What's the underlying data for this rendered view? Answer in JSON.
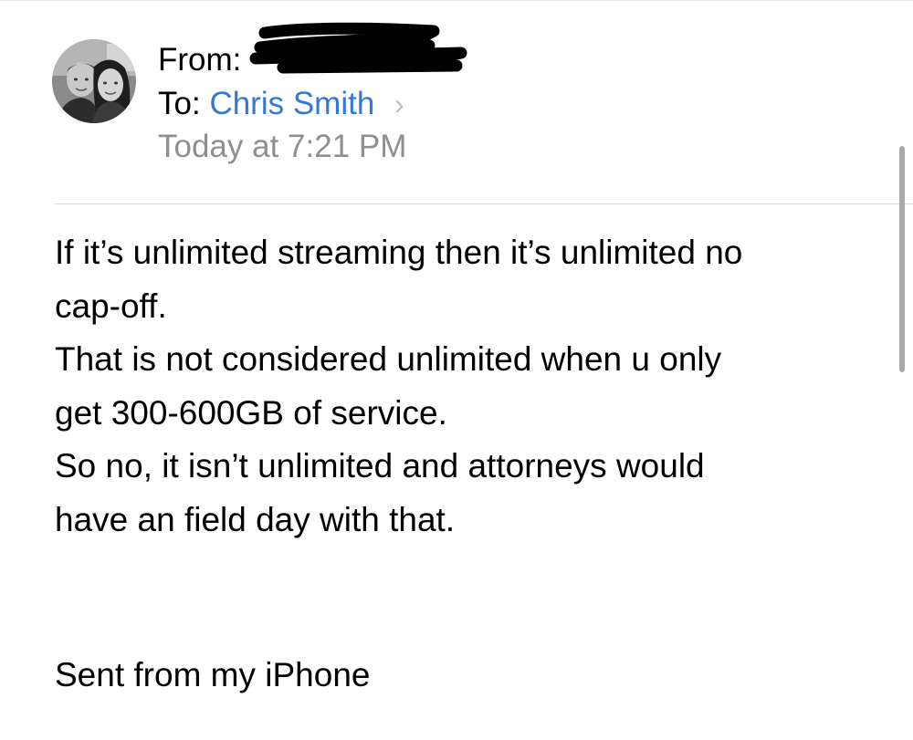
{
  "message": {
    "from_label": "From:",
    "to_label": "To:",
    "to_name": "Chris Smith",
    "chevron": "›",
    "date": "Today at 7:21 PM",
    "body_lines": [
      "If it’s unlimited streaming then it’s unlimited no",
      "cap-off.",
      "That is not considered unlimited when u only",
      "get 300-600GB of service.",
      "So no, it isn’t unlimited and attorneys would",
      "have an field day with that."
    ],
    "signature": "Sent from my iPhone"
  },
  "colors": {
    "link": "#3478d6",
    "secondary_text": "#8e8e93",
    "divider": "#d9d9dc",
    "chevron": "#bdbdc2",
    "scrollbar": "#a9a9ae"
  },
  "icons": {
    "avatar": "sender-photo",
    "disclosure": "chevron-right-icon"
  }
}
